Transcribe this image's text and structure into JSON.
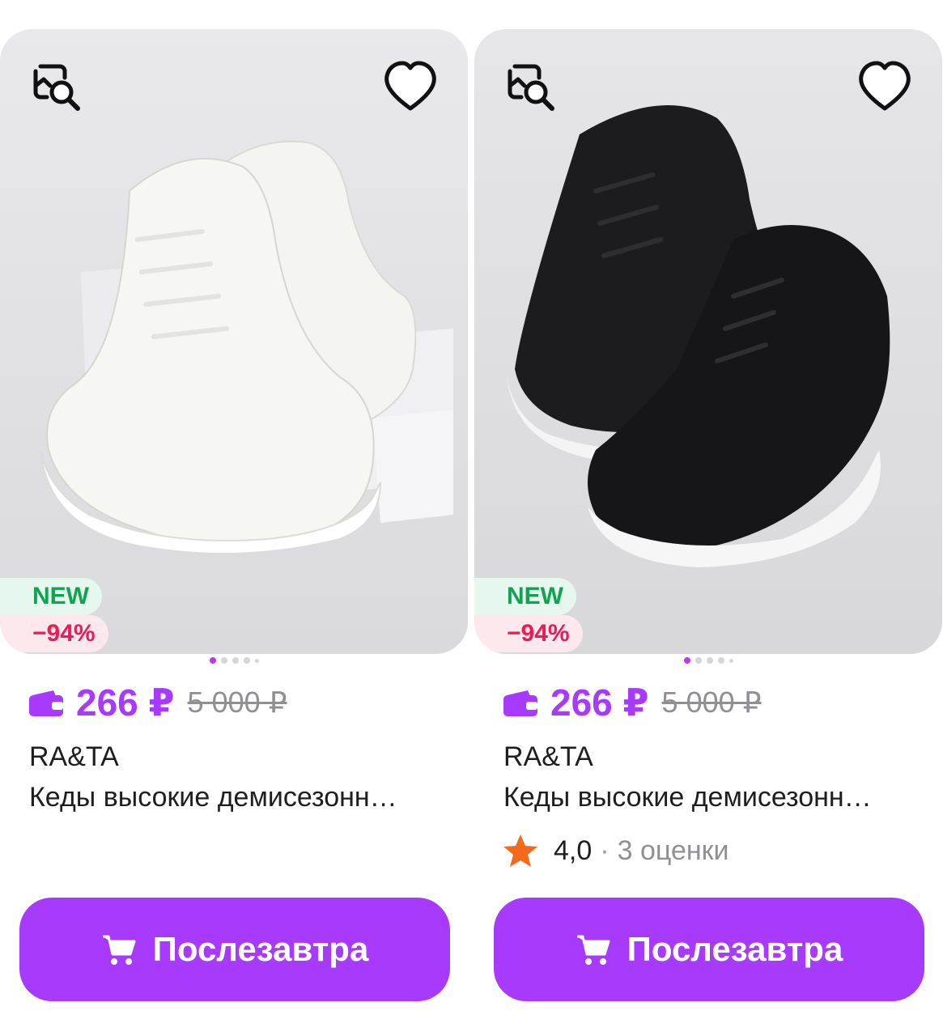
{
  "products": [
    {
      "badge_new": "NEW",
      "badge_discount": "−94%",
      "price": "266 ₽",
      "old_price": "5 000 ₽",
      "brand": "RA&TA",
      "title": "Кеды высокие демисезонн…",
      "button_label": "Послезавтра",
      "image_color": "white",
      "active_photo_index": 0,
      "photo_count": 5
    },
    {
      "badge_new": "NEW",
      "badge_discount": "−94%",
      "price": "266 ₽",
      "old_price": "5 000 ₽",
      "brand": "RA&TA",
      "title": "Кеды высокие демисезонн…",
      "rating_score": "4,0",
      "rating_separator": "·",
      "rating_count": "3 оценки",
      "button_label": "Послезавтра",
      "image_color": "black",
      "active_photo_index": 0,
      "photo_count": 5
    }
  ],
  "colors": {
    "accent": "#a73afd",
    "new_badge_text": "#10a351",
    "discount_text": "#ec1a55",
    "star": "#f26a1b"
  },
  "icons": {
    "search": "image-search-icon",
    "favorite": "heart-icon",
    "wallet": "wallet-icon",
    "cart": "cart-icon",
    "star": "star-icon"
  }
}
